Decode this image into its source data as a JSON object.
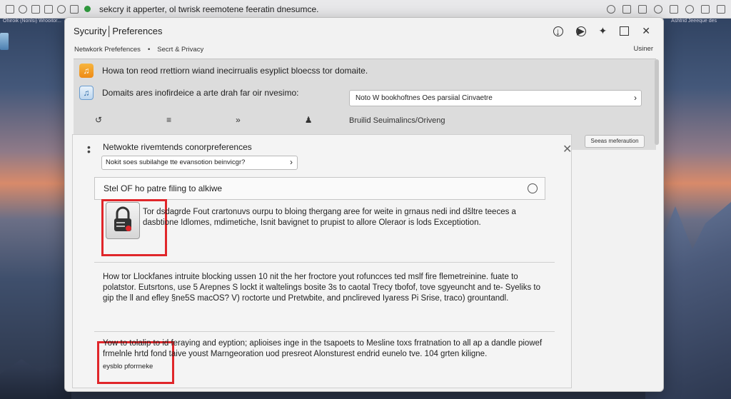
{
  "browser": {
    "url_text": "sekcry it apperter, ol twrisk reemotene feeratin dnesumce."
  },
  "desktop_labels": {
    "left": "Ohiroik (Nonlsi) Wrooitor...",
    "right": "Ashtrid Jeeeque des"
  },
  "window": {
    "title": "Sycurity│Preferences",
    "user_label": "Usiner",
    "breadcrumb": [
      "Netwkork Prefefences",
      "•",
      "Secrt & Privacy"
    ]
  },
  "top_panel": {
    "row1_text": "Howa ton reod rrettiorn wiand inecirrualis esyplict bloecss tor domaite.",
    "row2_text": "Domaits ares inofirdeice a arte drah far oir nvesimo:",
    "select_value": "Noto W bookhoftnes Oes parsiial Cinvaetre",
    "row3_label": "Bruilid Seuimalincs/Oriveng",
    "side_button": "Seeas meferaution"
  },
  "card": {
    "title": "Netwokte rivemtends conorpreferences",
    "select_value": "Nokit soes subilahge tte evansotion beinvicgr?",
    "toggle_label": "Stel OF ho patre filing to alkiwe",
    "lock_text": "Tor dsdagrde Fout crartonuvs ourpu to bloing thergang aree for weite in grnaus nedi ind dšltre teeces a dasbtione Idlomes, mdimetiche, Isnit bavignet to prupist to allore Oleraor is lods Exceptiotion.",
    "paragraph": "How tor Llockfanes intruite blocking ussen 10 nit the her froctore yout rofuncces ted mslf fire flemetreinine. fuate to polatstor. Eutsrtons, use 5 Arepnes S lockt it waltelings bosite 3s to caotal Trecy tbofof, tove sgyeuncht and te- Syeliks to gip the ll and efley §ne5S macOS? V) roctorte und Pretwbite, and pnclireved Iyaress Pi Srise, traco) grountandl.",
    "paragraph2": "Yow to tolalip to id feraying and eyption; aplioises inge in the tsapoets to Mesline toxs frratnation to all ap a dandle piowef frmelnle hrtd fond taive youst Marngeoration uod presreot Alonsturest endrid eunelo tve. 104 grten kiligne.",
    "paragraph2_tail": "eysblo pforrneke"
  }
}
